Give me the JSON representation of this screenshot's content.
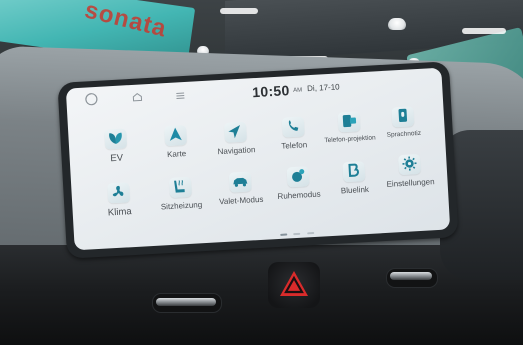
{
  "photo": {
    "background_poster_text": "sonata",
    "colors": {
      "screen_bg": "#eef1f4",
      "accent": "#1e7f96",
      "hazard_red": "#d92b2b"
    }
  },
  "infotainment": {
    "status_bar": {
      "circle_icon": "circle-icon",
      "home_icon": "home-icon",
      "menu_icon": "menu-icon",
      "time": "10:50",
      "ampm": "AM",
      "date": "Di, 17-10"
    },
    "apps_row1": [
      {
        "label": "EV",
        "icon": "ev-leaf-icon"
      },
      {
        "label": "Karte",
        "icon": "map-arrow-icon"
      },
      {
        "label": "Navigation",
        "icon": "navigation-icon"
      },
      {
        "label": "Telefon",
        "icon": "phone-icon"
      },
      {
        "label": "Telefon-projektion",
        "icon": "phone-projection-icon"
      },
      {
        "label": "Sprachnotiz",
        "icon": "voice-memo-icon"
      }
    ],
    "apps_row2": [
      {
        "label": "Klima",
        "icon": "fan-icon"
      },
      {
        "label": "Sitzheizung",
        "icon": "seat-heating-icon"
      },
      {
        "label": "Valet-Modus",
        "icon": "valet-car-icon"
      },
      {
        "label": "Ruhemodus",
        "icon": "quiet-mode-icon"
      },
      {
        "label": "Bluelink",
        "icon": "bluelink-icon"
      },
      {
        "label": "Einstellungen",
        "icon": "settings-gear-icon"
      }
    ],
    "page_indicator": {
      "pages": 3,
      "active": 1
    }
  },
  "controls": {
    "hazard_icon": "hazard-triangle-icon"
  }
}
